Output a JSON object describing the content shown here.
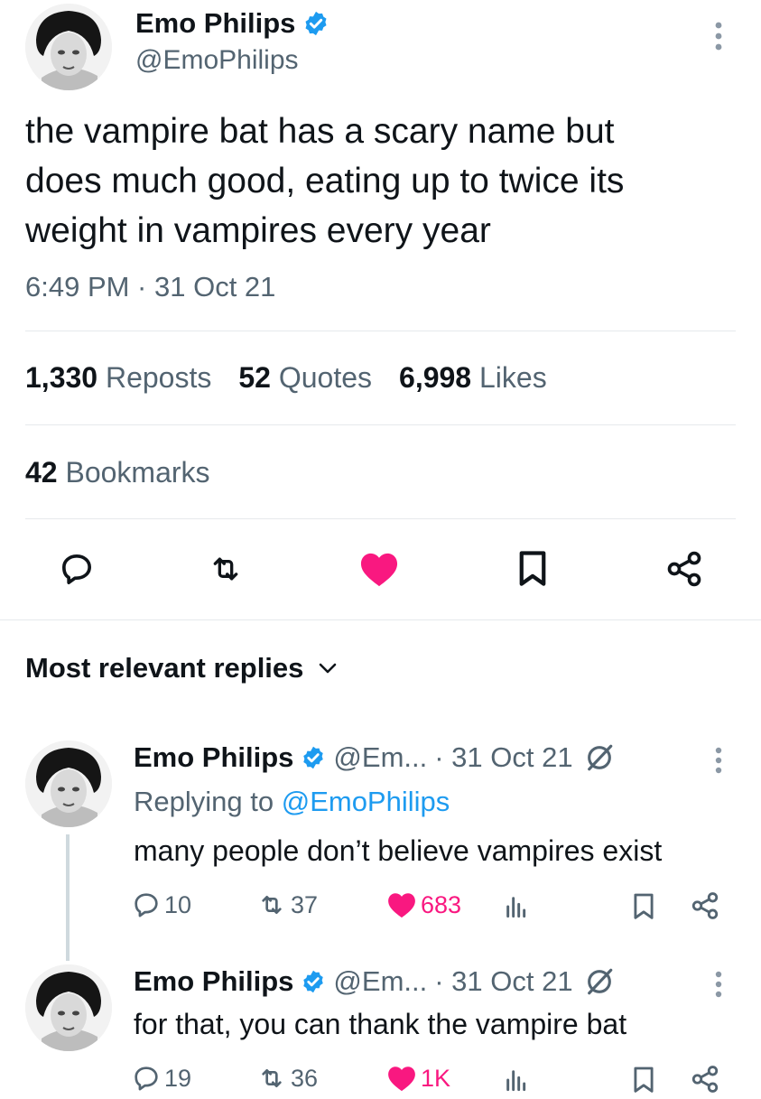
{
  "tweet": {
    "author_name": "Emo Philips",
    "author_handle": "@EmoPhilips",
    "text_lines": [
      "the vampire bat has a scary name but",
      "does much good, eating up to twice its",
      "weight in vampires every year"
    ],
    "timestamp": "6:49 PM · 31 Oct 21",
    "stats": {
      "reposts_count": "1,330",
      "reposts_label": "Reposts",
      "quotes_count": "52",
      "quotes_label": "Quotes",
      "likes_count": "6,998",
      "likes_label": "Likes",
      "bookmarks_count": "42",
      "bookmarks_label": "Bookmarks"
    },
    "liked": true
  },
  "replies_header": {
    "label": "Most relevant replies"
  },
  "replies": [
    {
      "author_name": "Emo Philips",
      "author_handle": "@Em...",
      "date": "· 31 Oct 21",
      "replying_prefix": "Replying to",
      "replying_handle": "@EmoPhilips",
      "text": "many people don’t believe vampires exist",
      "replies": "10",
      "reposts": "37",
      "likes": "683"
    },
    {
      "author_name": "Emo Philips",
      "author_handle": "@Em...",
      "date": "· 31 Oct 21",
      "text": "for that, you can thank the vampire bat",
      "replies": "19",
      "reposts": "36",
      "likes": "1K"
    }
  ],
  "colors": {
    "like": "#f91880",
    "verified": "#1d9bf0",
    "muted": "#536471",
    "divider": "#e6e9ec"
  }
}
